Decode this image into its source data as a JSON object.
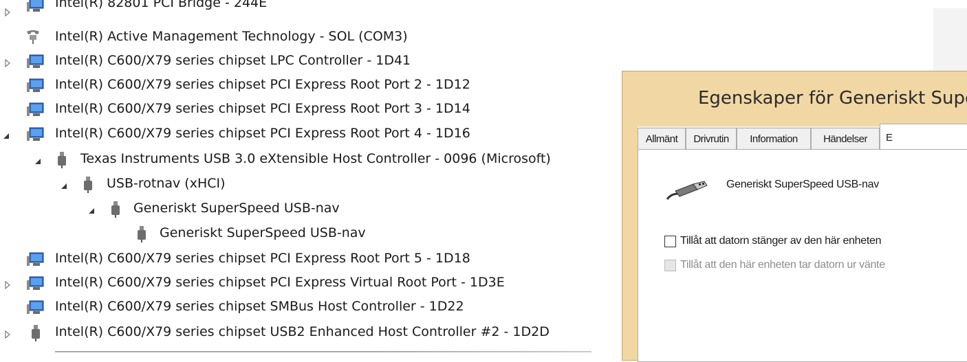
{
  "tree": {
    "items": [
      {
        "label": "Intel(R) 82801 PCI Bridge - 244E",
        "icon": "monitor-icon",
        "toggle": "collapsed"
      },
      {
        "label": "Intel(R) Active Management Technology - SOL (COM3)",
        "icon": "telephone-icon",
        "toggle": "none"
      },
      {
        "label": "Intel(R) C600/X79 series chipset LPC Controller - 1D41",
        "icon": "monitor-icon",
        "toggle": "collapsed"
      },
      {
        "label": "Intel(R) C600/X79 series chipset PCI Express Root Port 2 - 1D12",
        "icon": "monitor-icon",
        "toggle": "none"
      },
      {
        "label": "Intel(R) C600/X79 series chipset PCI Express Root Port 3 - 1D14",
        "icon": "monitor-icon",
        "toggle": "none"
      },
      {
        "label": "Intel(R) C600/X79 series chipset PCI Express Root Port 4 - 1D16",
        "icon": "monitor-icon",
        "toggle": "expanded"
      },
      {
        "label": "Texas Instruments USB 3.0 eXtensible Host Controller - 0096 (Microsoft)",
        "icon": "usb-plug-icon",
        "toggle": "expanded"
      },
      {
        "label": "USB-rotnav (xHCI)",
        "icon": "usb-plug-icon",
        "toggle": "expanded"
      },
      {
        "label": "Generiskt SuperSpeed USB-nav",
        "icon": "usb-plug-icon",
        "toggle": "expanded"
      },
      {
        "label": "Generiskt SuperSpeed USB-nav",
        "icon": "usb-plug-icon",
        "toggle": "none"
      },
      {
        "label": "Intel(R) C600/X79 series chipset PCI Express Root Port 5 - 1D18",
        "icon": "monitor-icon",
        "toggle": "none"
      },
      {
        "label": "Intel(R) C600/X79 series chipset PCI Express Virtual Root Port - 1D3E",
        "icon": "monitor-icon",
        "toggle": "collapsed"
      },
      {
        "label": "Intel(R) C600/X79 series chipset SMBus Host Controller - 1D22",
        "icon": "monitor-icon",
        "toggle": "none"
      },
      {
        "label": "Intel(R) C600/X79 series chipset USB2 Enhanced Host Controller #2 - 1D2D",
        "icon": "usb-plug-icon",
        "toggle": "collapsed"
      }
    ]
  },
  "dialog": {
    "title": "Egenskaper för Generiskt Supe",
    "tabs": [
      "Allmänt",
      "Drivrutin",
      "Information",
      "Händelser",
      "E"
    ],
    "device_name": "Generiskt SuperSpeed USB-nav",
    "option_power_off": "Tillåt att datorn stänger av den här enheten",
    "option_wake": "Tillåt att den här enheten tar datorn ur vänte"
  },
  "colors": {
    "dialog_frame": "#f1d7a3",
    "monitor_screen": "#2f6fc8"
  }
}
